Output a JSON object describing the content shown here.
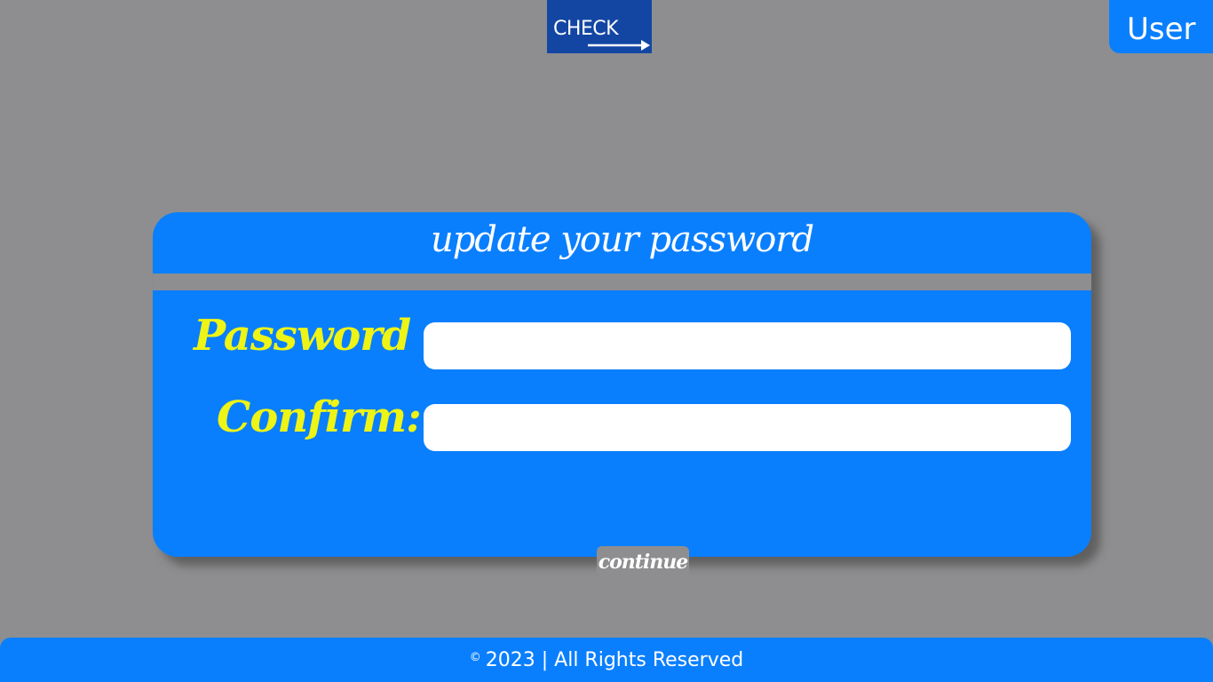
{
  "header": {
    "logo_text": "CHECK",
    "user_label": "User"
  },
  "card": {
    "title": "update your password",
    "password_label": "Password :",
    "password_value": "",
    "confirm_label": "Confirm:",
    "confirm_value": "",
    "continue_label": "continue"
  },
  "footer": {
    "copyright_symbol": "©",
    "text": "2023 | All Rights Reserved"
  },
  "colors": {
    "background": "#8e8e90",
    "accent_blue": "#0a7ffe",
    "logo_blue": "#1346a3",
    "label_yellow": "#eef415"
  }
}
